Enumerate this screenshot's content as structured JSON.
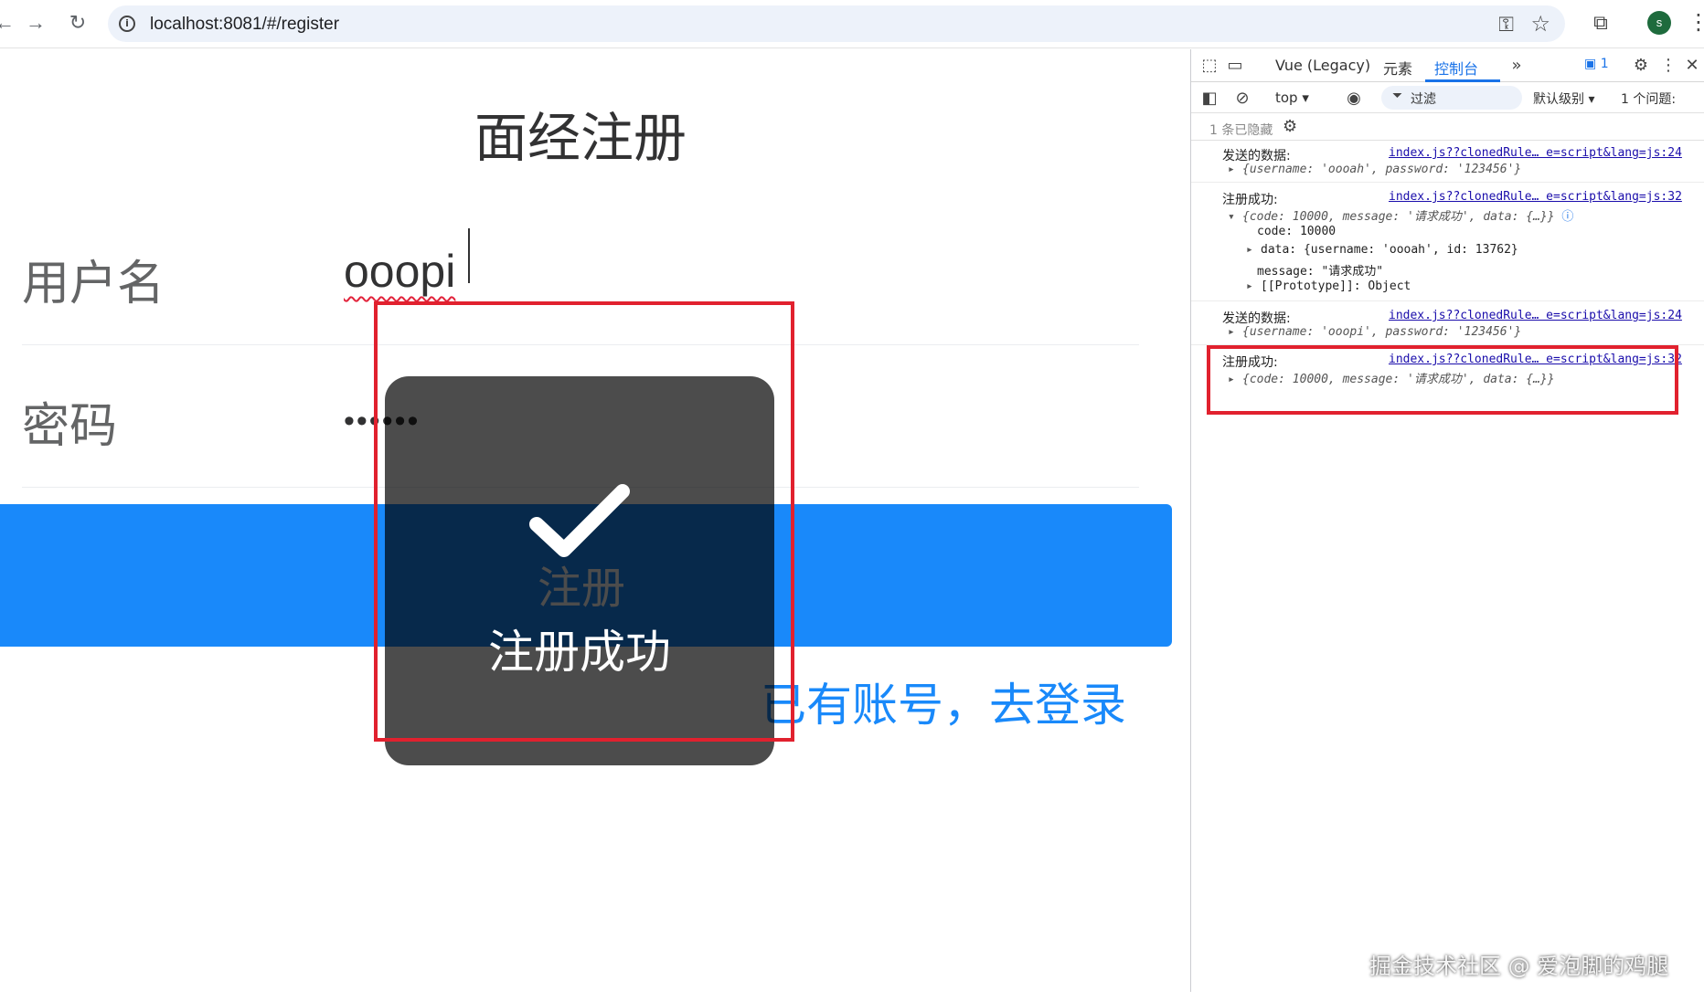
{
  "browser": {
    "url": "localhost:8081/#/register",
    "back_icon": "arrow-left-icon",
    "forward_icon": "arrow-right-icon",
    "reload_icon": "reload-icon",
    "profile_initial": "s"
  },
  "page": {
    "title": "面经注册",
    "username_label": "用户名",
    "username_value": "ooopi",
    "password_label": "密码",
    "password_value": "••••••",
    "register_button": "注册",
    "login_link": "已有账号，去登录",
    "toast_text": "注册成功"
  },
  "devtools": {
    "tabs": [
      "Vue (Legacy)",
      "元素",
      "控制台"
    ],
    "active_tab": "控制台",
    "messages_badge": "1",
    "context": "top",
    "filter_placeholder": "过滤",
    "level": "默认级别",
    "issues": "1 个问题:",
    "hidden": "1 条已隐藏",
    "logs": [
      {
        "label": "发送的数据:",
        "source": "index.js??clonedRule… e=script&lang=js:24",
        "lines": [
          "{username: 'oooah', password: '123456'}"
        ]
      },
      {
        "label": "注册成功:",
        "source": "index.js??clonedRule… e=script&lang=js:32",
        "summary": "{code: 10000, message: '请求成功', data: {…}}",
        "props": [
          "code: 10000",
          "data: {username: 'oooah', id: 13762}",
          "message: \"请求成功\"",
          "[[Prototype]]: Object"
        ]
      },
      {
        "label": "发送的数据:",
        "source": "index.js??clonedRule… e=script&lang=js:24",
        "lines": [
          "{username: 'ooopi', password: '123456'}"
        ]
      },
      {
        "label": "注册成功:",
        "source": "index.js??clonedRule… e=script&lang=js:32",
        "lines": [
          "{code: 10000, message: '请求成功', data: {…}}"
        ]
      }
    ]
  },
  "watermark": "掘金技术社区 @ 爱泡脚的鸡腿"
}
